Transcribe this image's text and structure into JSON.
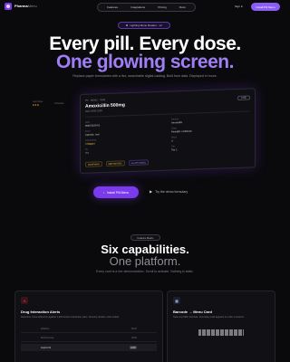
{
  "nav": {
    "brand": "Pharma",
    "brand_suffix": "Menu",
    "links": [
      "Features",
      "Integrations",
      "Pricing",
      "Docs"
    ],
    "sign_in": "Sign in",
    "cta": "Install Pill Menu"
  },
  "hero": {
    "badge": "Lighting Menu Reader · v2",
    "headline_1": "Every pill. Every dose.",
    "headline_2": "One glowing screen.",
    "subtext": "Replace paper formularies with a live, searchable digital catalog. Built from data. Displayed in hours."
  },
  "side_annotation": {
    "label": "next dose",
    "value": "2.4 h",
    "note": "schedule"
  },
  "product_card": {
    "top_label": "RX · MENU · ITEM",
    "title": "Amoxicillin 500mg",
    "code": "NDC 0093-3109",
    "status": "LIVE",
    "fields": [
      {
        "key": "NDC",
        "value": "0093-3109-01"
      },
      {
        "key": "Generic",
        "value": "Amoxicillin"
      },
      {
        "key": "Form",
        "value": "Capsule, oral"
      },
      {
        "key": "Class",
        "value": "Penicillin / Antibiotic"
      },
      {
        "key": "Interactions",
        "value": "3 flagged"
      },
      {
        "key": "Stock",
        "value": "In"
      },
      {
        "key": "Rx",
        "value": "Yes"
      },
      {
        "key": "Tier",
        "value": "Tier 1"
      }
    ],
    "chips": [
      "WARFARIN",
      "METHOTREX",
      "ALLOPURINOL"
    ]
  },
  "cta_row": {
    "primary": "Install Pill Menu",
    "secondary": "Try the demo formulary"
  },
  "capabilities": {
    "badge": "Feature Matrix",
    "heading_1": "Six capabilities.",
    "heading_2": "One platform.",
    "subtext": "Every card is a live demonstration. Scroll to activate. Nothing is static."
  },
  "feature_cards": [
    {
      "title": "Drug Interaction Alerts",
      "description": "Real-time cross-reference against 1,200 known interaction pairs. Severity-ranked, color-coded.",
      "rows": [
        {
          "key": "Warfarin",
          "value": "HIGH"
        },
        {
          "key": "Methotrexate",
          "value": "MOD"
        },
        {
          "key": "Aspirin 81",
          "value": "LOW"
        }
      ]
    },
    {
      "title": "Barcode → Menu Card",
      "description": "Scan any NDC barcode. Formulary card appears in under a second."
    }
  ],
  "colors": {
    "accent": "#7c3aed",
    "accent_light": "#a07ef5",
    "background": "#0a0a0c"
  }
}
